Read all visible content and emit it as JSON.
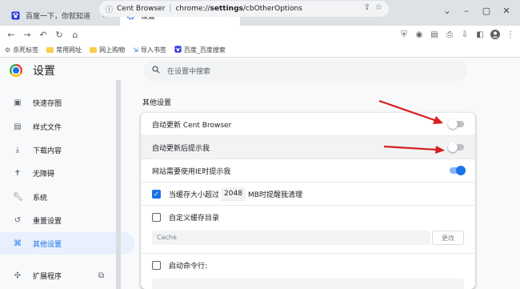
{
  "tabs": [
    {
      "title": "百度一下，你就知道",
      "icon": "baidu-paw-icon",
      "active": false
    },
    {
      "title": "设置",
      "icon": "gear-icon",
      "active": true
    }
  ],
  "omnibox": {
    "brand": "Cent Browser",
    "separator": "|",
    "url_host": "chrome://",
    "url_path": "settings",
    "url_rest": "/cbOtherOptions"
  },
  "bookmarks": [
    {
      "label": "杀死标签",
      "icon": "gear-icon"
    },
    {
      "label": "常用网址",
      "icon": "folder-icon"
    },
    {
      "label": "网上购物",
      "icon": "folder-icon"
    },
    {
      "label": "导入书签",
      "icon": "import-icon"
    },
    {
      "label": "百度_百度搜索",
      "icon": "baidu-paw-icon"
    }
  ],
  "settings": {
    "title": "设置",
    "search_placeholder": "在设置中搜索"
  },
  "sidebar": {
    "items": [
      {
        "label": "快速存图",
        "icon": "image-save-icon",
        "active": false
      },
      {
        "label": "样式文件",
        "icon": "style-file-icon",
        "active": false
      },
      {
        "label": "下载内容",
        "icon": "download-icon",
        "active": false
      },
      {
        "label": "无障碍",
        "icon": "accessibility-icon",
        "active": false
      },
      {
        "label": "系统",
        "icon": "wrench-icon",
        "active": false
      },
      {
        "label": "重置设置",
        "icon": "reset-icon",
        "active": false
      },
      {
        "label": "其他设置",
        "icon": "other-settings-icon",
        "active": true
      },
      {
        "label": "扩展程序",
        "icon": "puzzle-icon",
        "active": false
      }
    ]
  },
  "content": {
    "section_title": "其他设置",
    "rows": {
      "auto_update": {
        "label": "自动更新 Cent Browser",
        "on": false
      },
      "update_notify": {
        "label": "自动更新后提示我",
        "on": false
      },
      "ie_prompt": {
        "label": "网站需要使用IE时提示我",
        "on": true
      },
      "cache_clean": {
        "prefix": "当缓存大小超过",
        "value": "2048",
        "suffix": "MB时提醒我清理",
        "checked": true
      },
      "custom_cache": {
        "label": "自定义缓存目录",
        "checked": false
      },
      "startup_cmd": {
        "label": "启动命令行:",
        "checked": false
      }
    },
    "cache_placeholder": "Cache",
    "change_button": "更改"
  },
  "colors": {
    "accent": "#1a73e8",
    "arrow": "#d81e1e"
  }
}
